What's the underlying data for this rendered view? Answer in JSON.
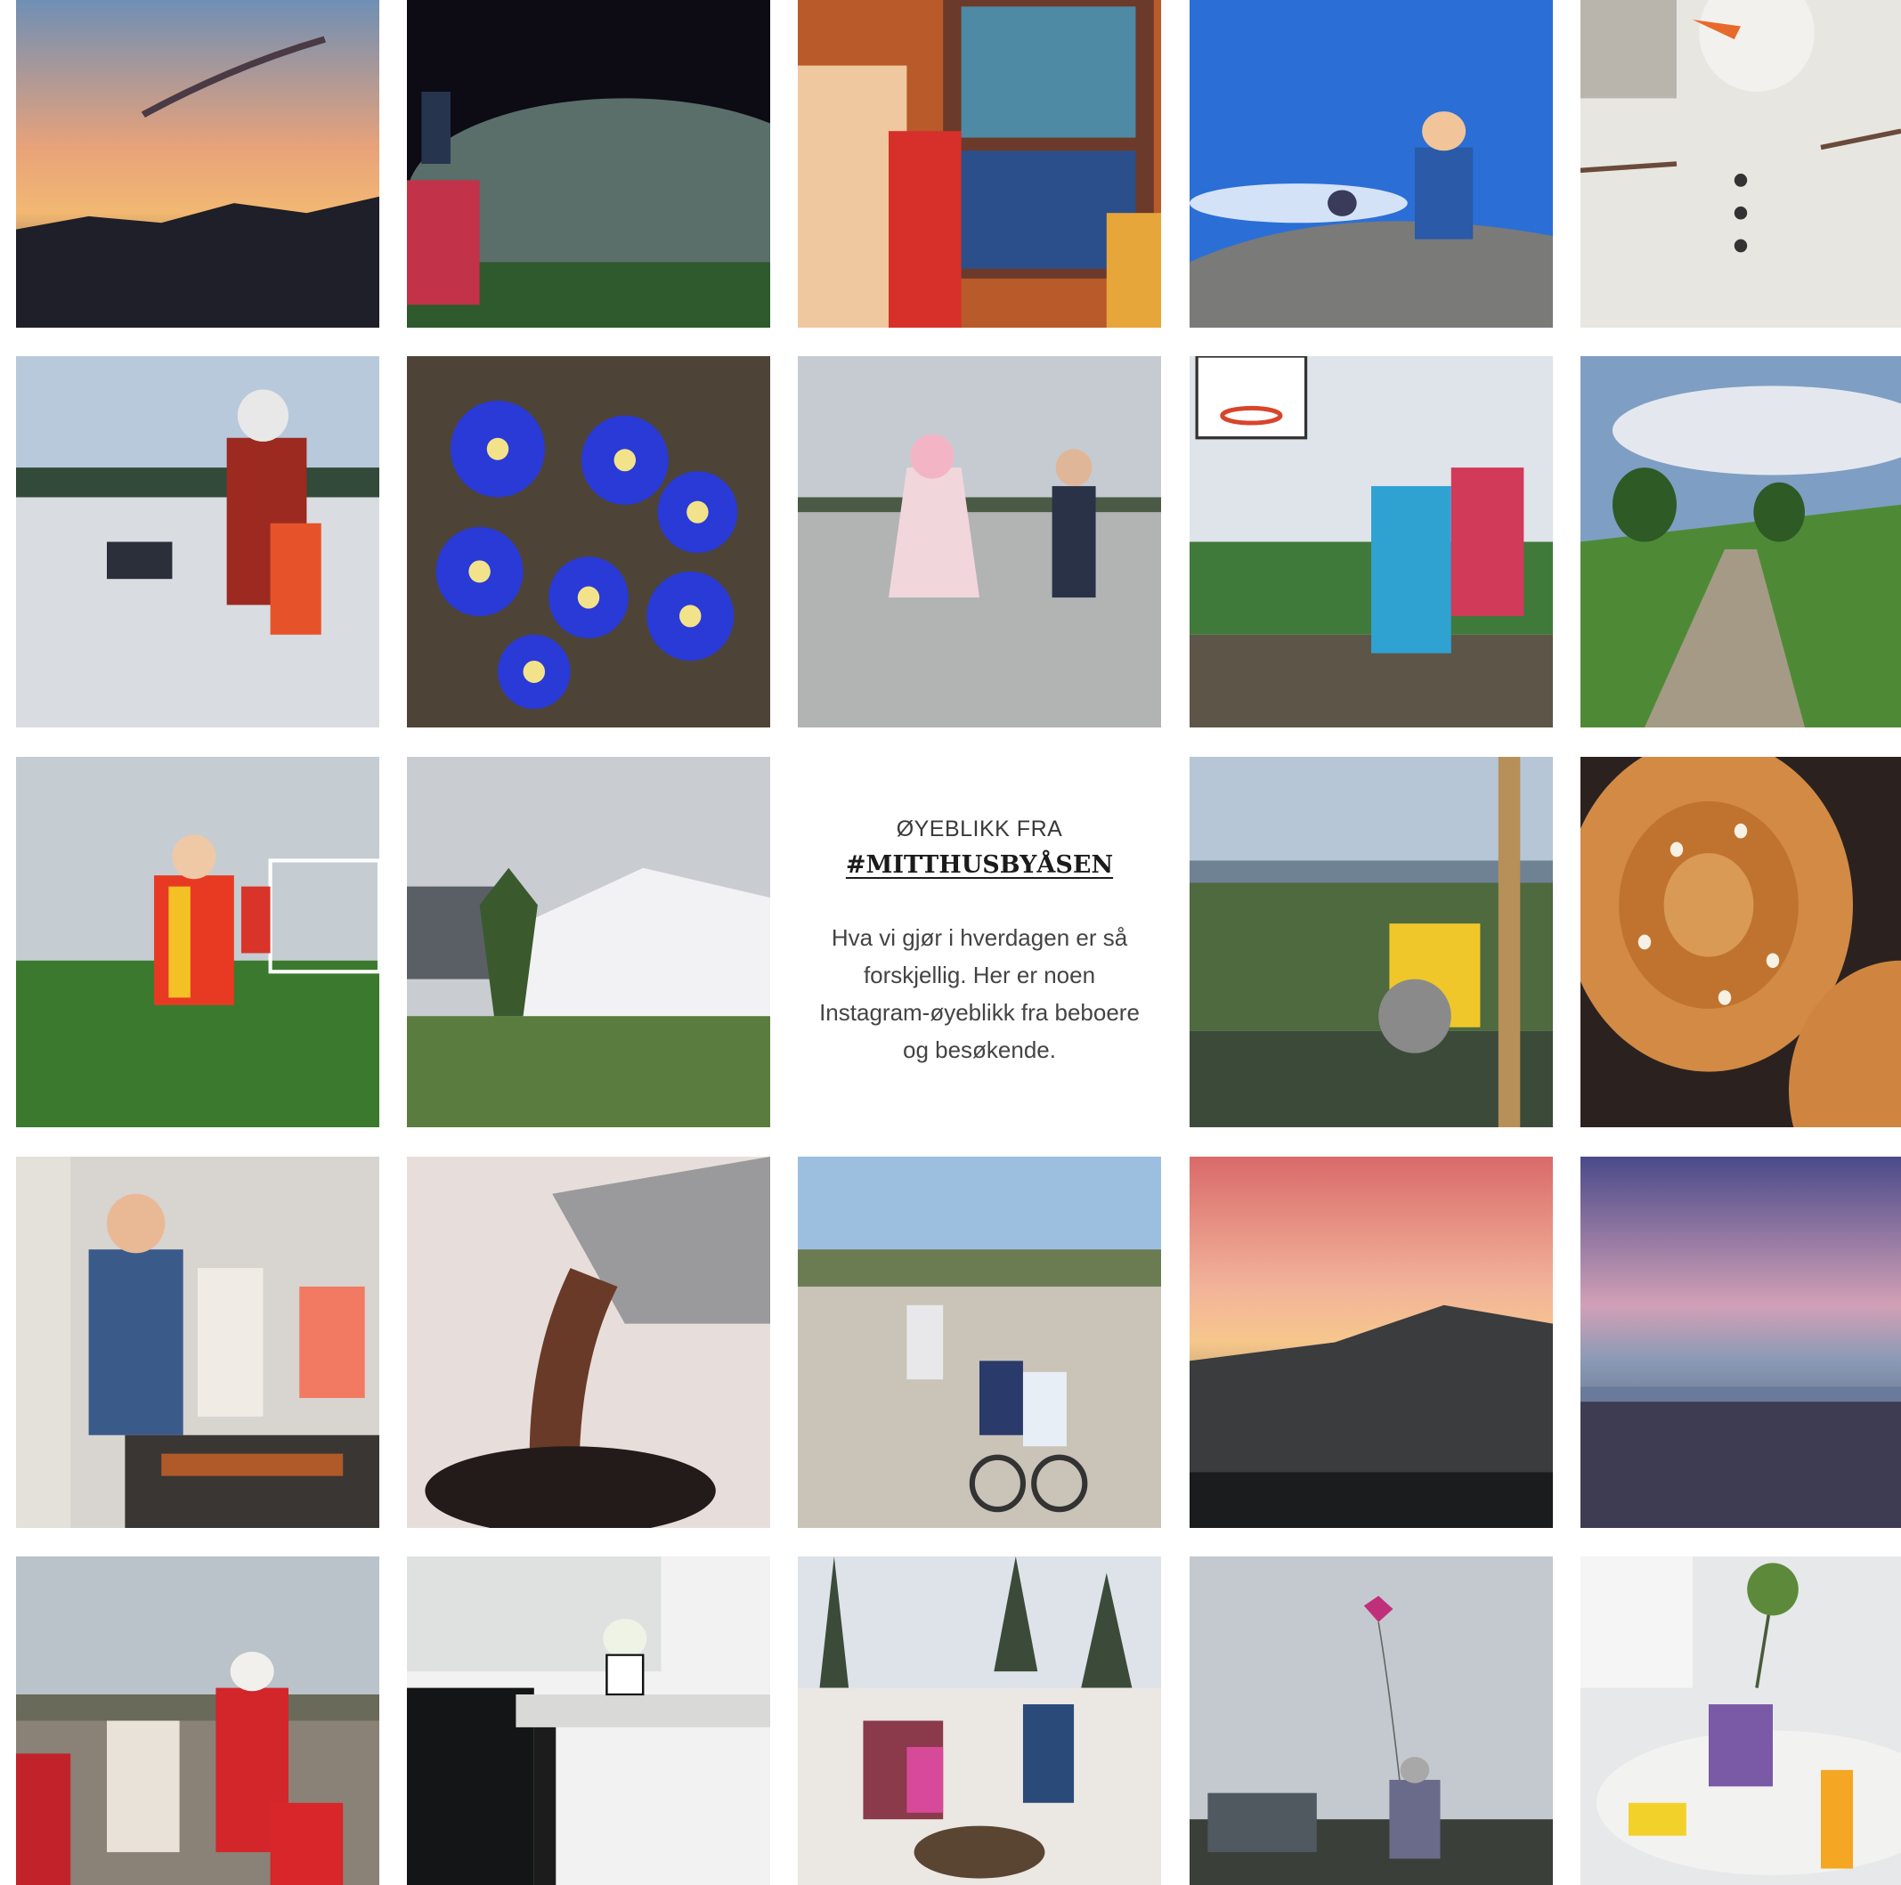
{
  "feature": {
    "kicker": "ØYEBLIKK FRA",
    "hashtag": "#MITTHUSBYÅSEN",
    "body": "Hva vi gjør i hverdagen er så forskjellig. Her er noen Instagram-øyeblikk fra beboere og besøkende."
  }
}
